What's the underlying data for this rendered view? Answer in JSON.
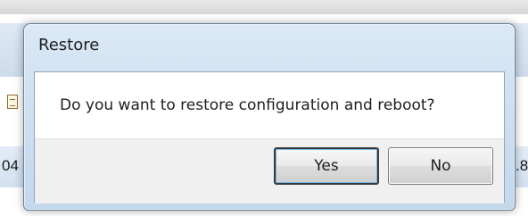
{
  "background_app": {
    "left_cell_text": "04",
    "right_cell_text": ".8"
  },
  "dialog": {
    "title": "Restore",
    "message": "Do you want to restore configuration and reboot?",
    "buttons": {
      "yes_label": "Yes",
      "no_label": "No"
    },
    "default_button": "Yes"
  },
  "colors": {
    "dialog_frame": "#c4d8ec",
    "dialog_border": "#6b7f99",
    "content_background": "#ffffff",
    "button_area_background": "#f0f0f0",
    "default_button_focus": "#6fb7e8"
  }
}
